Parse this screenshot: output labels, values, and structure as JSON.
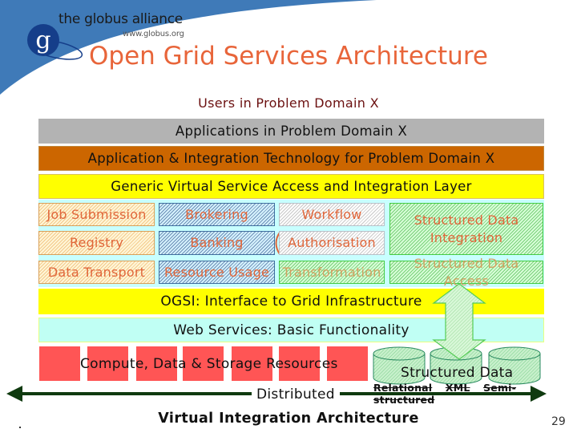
{
  "header": {
    "brand_name": "the globus alliance",
    "brand_url": "www.globus.org",
    "logo_letter": "g",
    "title": "Open Grid Services Architecture"
  },
  "colors": {
    "title": "#e8653a",
    "swoosh_blue": "#3f7ab8",
    "logo_blue": "#153e8a",
    "gray_bar": "#b3b3b3",
    "orange_bar": "#cc6600",
    "yellow_bar": "#ffff00",
    "cyan_layer": "#c8ffff",
    "webservices": "#c0fff4",
    "resources_red": "#ff5555",
    "arrow_green": "#0f3a0f"
  },
  "layers": {
    "users": "Users in Problem Domain X",
    "applications": "Applications in Problem Domain X",
    "app_integration": "Application & Integration Technology for Problem Domain X",
    "generic_access": "Generic Virtual Service Access and Integration Layer",
    "ogsi": "OGSI: Interface to Grid Infrastructure",
    "web_services": "Web Services: Basic Functionality"
  },
  "modules": {
    "job_submission": "Job Submission",
    "brokering": "Brokering",
    "workflow": "Workflow",
    "structured_data_integration": "Structured Data Integration",
    "registry": "Registry",
    "banking": "Banking",
    "authorisation": "Authorisation",
    "data_transport": "Data Transport",
    "resource_usage": "Resource Usage",
    "transformation": "Transformation",
    "structured_data_access": "Structured Data Access"
  },
  "resources": {
    "compute_label": "Compute, Data & Storage Resources",
    "structured_data_label": "Structured Data",
    "data_types": [
      "Relational",
      "XML",
      "Semi-structured"
    ],
    "distributed_label": "Distributed"
  },
  "footer": {
    "caption": "Virtual Integration Architecture",
    "page_number": "29"
  }
}
